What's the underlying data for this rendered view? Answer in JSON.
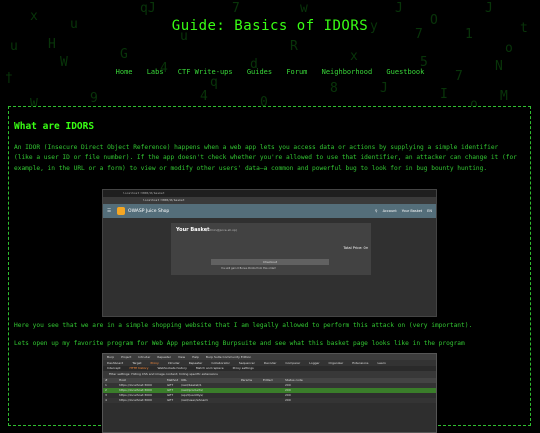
{
  "site": {
    "title": "Guide: Basics of IDORS"
  },
  "nav": {
    "items": [
      "Home",
      "Labs",
      "CTF Write-ups",
      "Guides",
      "Forum",
      "Neighborhood",
      "Guestbook"
    ]
  },
  "rain_glyphs": [
    "qJ",
    "7",
    "w",
    "J",
    "J",
    "x",
    "O",
    "1",
    "7",
    "u",
    "o",
    "H",
    "N",
    "7",
    "J",
    "8",
    "4",
    "0",
    "†",
    "W",
    "G",
    "x",
    "d",
    "M",
    "o",
    "W",
    "9",
    "4",
    "5",
    "R",
    "y",
    "u",
    "u",
    "t",
    "q",
    "I"
  ],
  "article": {
    "heading": "What are IDORS",
    "intro": "An IDOR (Insecure Direct Object Reference) happens when a web app lets you access data or actions by supplying a simple identifier (like a user ID or file number). If the app doesn't check whether you're allowed to use that identifier, an attacker can change it (for example, in the URL or a form) to view or modify other users' data—a common and powerful bug to look for in bug bounty hunting.",
    "para2": "Here you see that we are in a simple shopping website that I am legally allowed to perform this attack on (very important).",
    "para3": "Lets open up my favorite program for Web App pentesting Burpsuite and see what this basket page looks like in the program"
  },
  "shot1": {
    "tab": "localhost:3000/#/basket",
    "url": "localhost:3000/#/basket",
    "app_name": "OWASP Juice Shop",
    "account": "Account",
    "basket": "Your Basket",
    "lang": "EN",
    "card_title": "Your Basket",
    "card_user": "(admin@juice-sh.op)",
    "total": "Total Price: 0¤",
    "checkout": "Checkout",
    "note": "You will gain 0 Bonus Points from this order!"
  },
  "shot2": {
    "menu": [
      "Burp",
      "Project",
      "Intruder",
      "Repeater",
      "View",
      "Help",
      "Burp Suite Community Edition"
    ],
    "tabs": [
      "Dashboard",
      "Target",
      "Proxy",
      "Intruder",
      "Repeater",
      "Collaborator",
      "Sequencer",
      "Decoder",
      "Comparer",
      "Logger",
      "Organizer",
      "Extensions",
      "Learn"
    ],
    "active_tab": "Proxy",
    "subtabs": [
      "Intercept",
      "HTTP history",
      "WebSockets history",
      "Match and replace",
      "Proxy settings"
    ],
    "filter": "Filter settings: Hiding CSS and image content; hiding specific extensions",
    "columns": [
      "#",
      "Host",
      "Method",
      "URL",
      "Params",
      "Edited",
      "Status code"
    ],
    "rows": [
      [
        "1",
        "https://localhost:3000",
        "GET",
        "/rest/basket/1",
        "",
        "",
        "200"
      ],
      [
        "2",
        "https://localhost:3000",
        "GET",
        "/rest/products/",
        "",
        "",
        "200"
      ],
      [
        "3",
        "https://localhost:3000",
        "GET",
        "/api/Quantitys/",
        "",
        "",
        "200"
      ],
      [
        "4",
        "https://localhost:3000",
        "GET",
        "/rest/user/whoami",
        "",
        "",
        "200"
      ]
    ]
  },
  "colors": {
    "accent": "#39ff14",
    "text": "#32c832",
    "rain": "#0f5f12",
    "background": "#000000"
  }
}
